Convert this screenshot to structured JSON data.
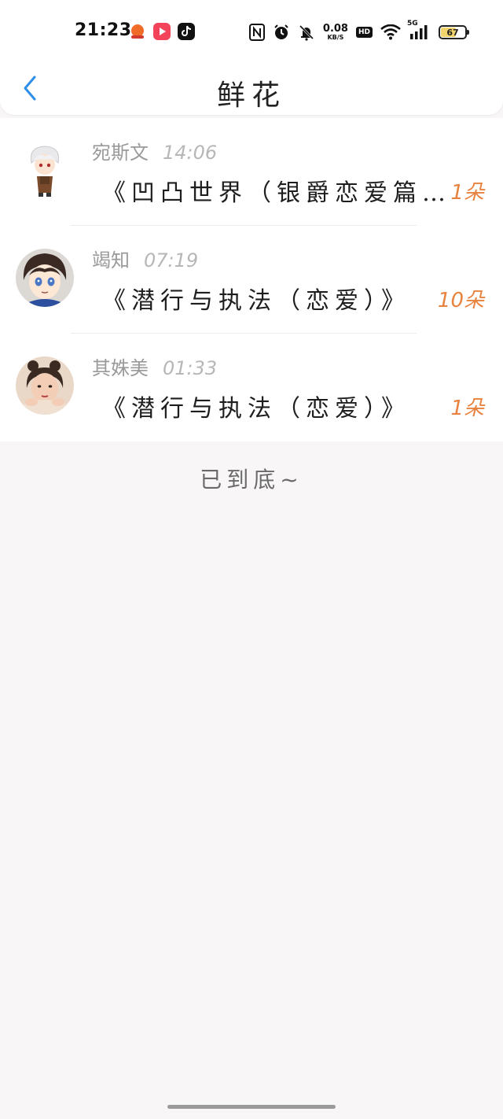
{
  "status_bar": {
    "time": "21:23",
    "net_speed_value": "0.08",
    "net_speed_unit": "KB/S",
    "hd": "HD",
    "network": "5G",
    "battery_percent": "67"
  },
  "nav": {
    "title": "鲜花"
  },
  "items": [
    {
      "user": "宛斯文",
      "time": "14:06",
      "title": "《凹凸世界（银爵恋爱篇…",
      "count": "1朵"
    },
    {
      "user": "竭知",
      "time": "07:19",
      "title": "《潜行与执法（恋爱）》",
      "count": "10朵"
    },
    {
      "user": "其姝美",
      "time": "01:33",
      "title": "《潜行与执法（恋爱）》",
      "count": "1朵"
    }
  ],
  "footer": {
    "end_text": "已到底~"
  },
  "colors": {
    "accent": "#2e8fe8",
    "count": "#e8823f",
    "battery": "#f3d36b"
  }
}
